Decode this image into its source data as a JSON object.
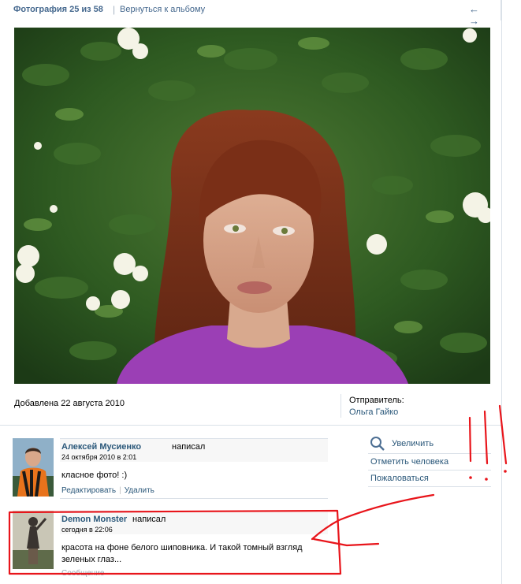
{
  "header": {
    "title": "Фотография 25 из 58",
    "separator": "|",
    "back_link": "Вернуться к альбому",
    "nav_arrows": "← →"
  },
  "photo": {
    "description_icon": "photo-portrait"
  },
  "info": {
    "added": "Добавлена 22 августа 2010",
    "sender_label": "Отправитель:",
    "sender_name": "Ольга Гайко"
  },
  "comments": [
    {
      "author": "Алексей Мусиенко",
      "wrote": "написал",
      "date": "24 октября 2010 в 2:01",
      "text": "класное фото! :)",
      "actions": [
        "Редактировать",
        "Удалить"
      ]
    },
    {
      "author": "Demon Monster",
      "wrote": "написал",
      "date": "сегодня в 22:06",
      "text": "красота на фоне белого шиповника. И такой томный взгляд зеленых глаз...",
      "actions": [
        "Сообщение"
      ]
    }
  ],
  "side_actions": {
    "zoom": "Увеличить",
    "tag_person": "Отметить человека",
    "report": "Пожаловаться"
  },
  "colors": {
    "link": "#2b587a",
    "title": "#45688e",
    "divider": "#dae1e8",
    "annotation": "#e8151b"
  }
}
